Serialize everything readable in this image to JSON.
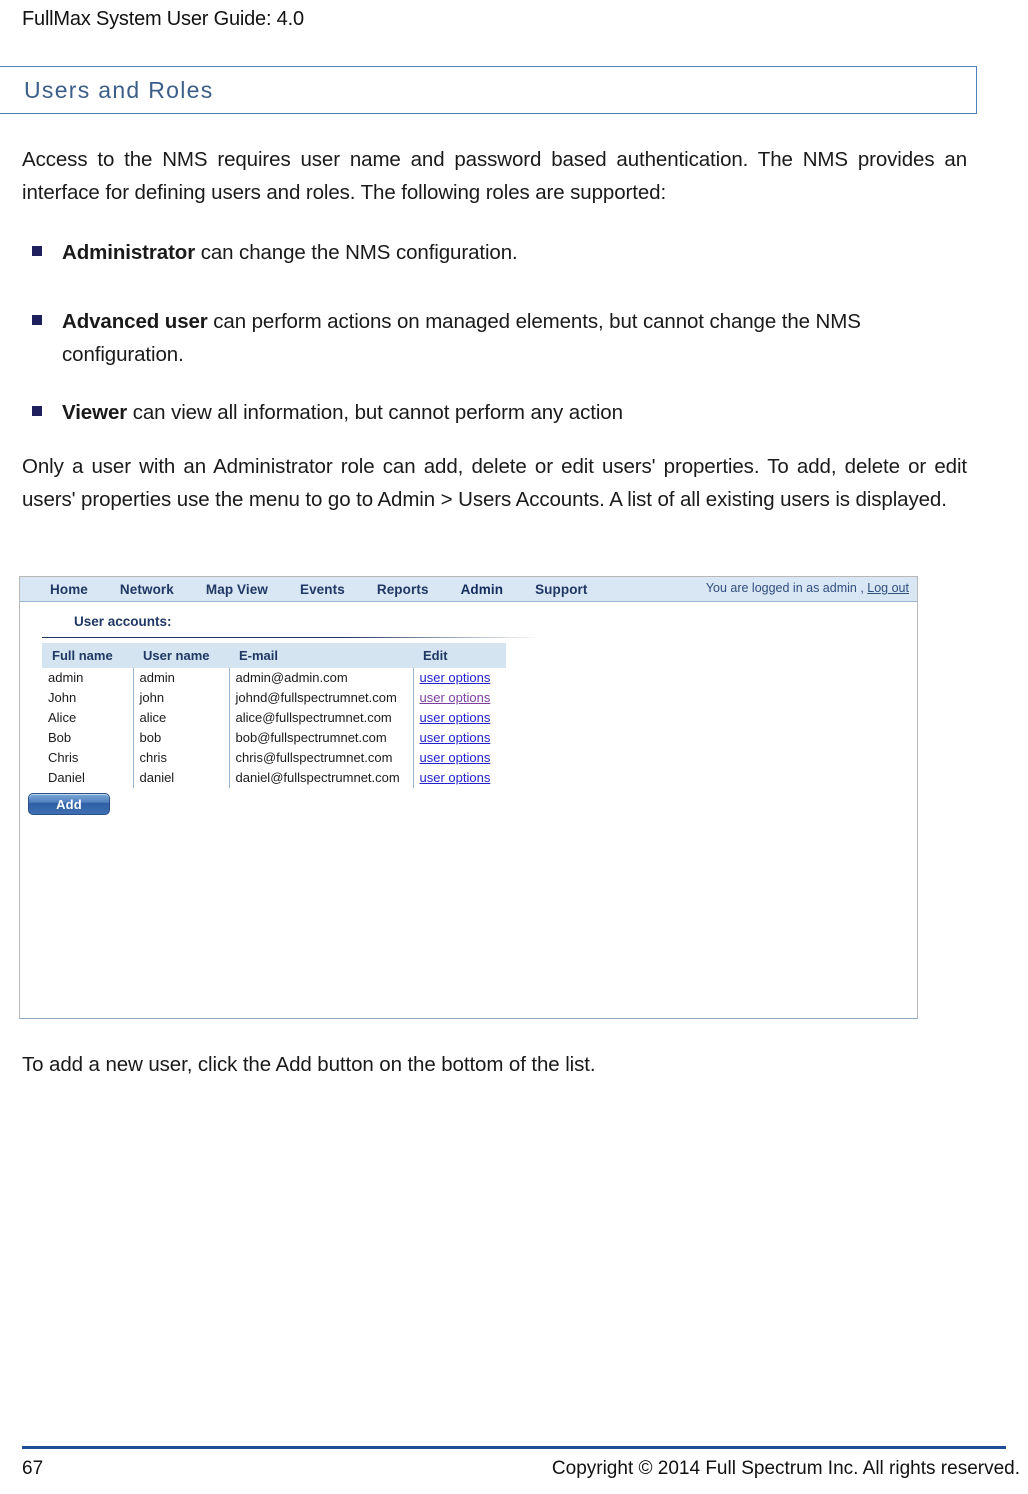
{
  "document": {
    "running_head": "FullMax System User Guide: 4.0",
    "section_heading": "Users and Roles",
    "intro_paragraph": "Access to the NMS requires user name and password based authentication. The NMS provides an interface for defining users and roles. The following roles are supported:",
    "roles": [
      {
        "term": "Administrator",
        "description": " can change the NMS configuration."
      },
      {
        "term": "Advanced user",
        "description": " can perform actions on managed elements, but cannot change the NMS configuration."
      },
      {
        "term": "Viewer",
        "description": " can view all information, but cannot perform any action"
      }
    ],
    "admin_paragraph": "Only a user with an Administrator role can add, delete or edit users' properties. To add, delete or edit users' properties use the menu to go to Admin > Users Accounts. A list of all existing users is displayed.",
    "closing_paragraph": "To add a new user, click the Add button on the bottom of the list."
  },
  "screenshot": {
    "navbar": {
      "items": [
        {
          "label": "Home",
          "active": false
        },
        {
          "label": "Network",
          "active": false
        },
        {
          "label": "Map View",
          "active": false
        },
        {
          "label": "Events",
          "active": false
        },
        {
          "label": "Reports",
          "active": false
        },
        {
          "label": "Admin",
          "active": true
        },
        {
          "label": "Support",
          "active": false
        }
      ],
      "session_text": "You are logged in as admin , ",
      "logout_label": "Log out"
    },
    "panel": {
      "title": "User accounts:",
      "columns": [
        "Full name",
        "User name",
        "E-mail",
        "Edit"
      ],
      "rows": [
        {
          "full_name": "admin",
          "user_name": "admin",
          "email": "admin@admin.com",
          "edit": "user options"
        },
        {
          "full_name": "John",
          "user_name": "john",
          "email": "johnd@fullspectrumnet.com",
          "edit": "user options"
        },
        {
          "full_name": "Alice",
          "user_name": "alice",
          "email": "alice@fullspectrumnet.com",
          "edit": "user options"
        },
        {
          "full_name": "Bob",
          "user_name": "bob",
          "email": "bob@fullspectrumnet.com",
          "edit": "user options"
        },
        {
          "full_name": "Chris",
          "user_name": "chris",
          "email": "chris@fullspectrumnet.com",
          "edit": "user options"
        },
        {
          "full_name": "Daniel",
          "user_name": "daniel",
          "email": "daniel@fullspectrumnet.com",
          "edit": "user options"
        }
      ],
      "add_button_label": "Add"
    }
  },
  "footer": {
    "page_number": "67",
    "copyright": "Copyright © 2014 Full Spectrum Inc. All rights reserved."
  },
  "colors": {
    "heading_accent": "#4f81bd",
    "heading_text": "#3c5f8a",
    "nav_background": "#d9e6f3",
    "nav_text": "#1f3864",
    "table_header_bg": "#d5e4f1",
    "link": "#2222cc",
    "link_visited": "#7b3fa0",
    "footer_rule": "#1f4e99",
    "bullet": "#1f1f5e"
  }
}
